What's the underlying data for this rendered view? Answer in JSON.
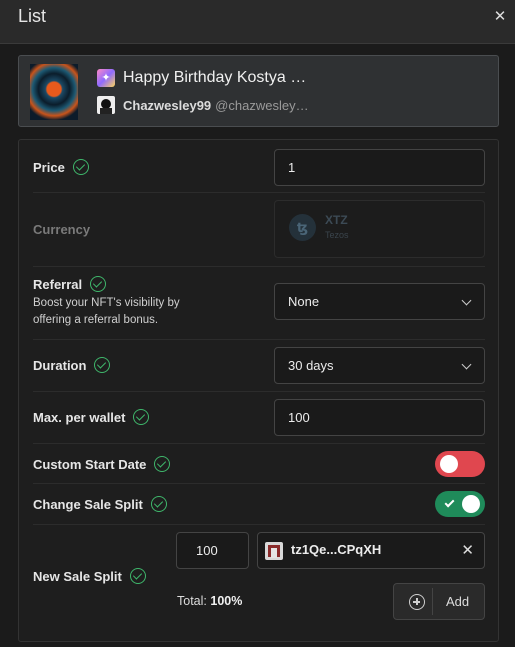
{
  "header": {
    "title": "List",
    "close_icon": "close-icon"
  },
  "nft": {
    "title": "Happy Birthday Kostya …",
    "title_icon": "party-popper-icon",
    "artist_name": "Chazwesley99",
    "artist_handle": "@chazwesley…"
  },
  "form": {
    "price": {
      "label": "Price",
      "value": "1"
    },
    "currency": {
      "label": "Currency",
      "symbol": "XTZ",
      "name": "Tezos",
      "logo_glyph": "ꜩ"
    },
    "referral": {
      "label": "Referral",
      "description": "Boost your NFT's visibility by offering a referral bonus.",
      "value": "None"
    },
    "duration": {
      "label": "Duration",
      "value": "30 days"
    },
    "max_per_wallet": {
      "label": "Max. per wallet",
      "value": "100"
    },
    "custom_start_date": {
      "label": "Custom Start Date",
      "enabled": false
    },
    "change_sale_split": {
      "label": "Change Sale Split",
      "enabled": true
    },
    "new_sale_split": {
      "label": "New Sale Split",
      "share": "100",
      "address": "tz1Qe...CPqXH",
      "total_label": "Total:",
      "total_value": "100%",
      "add_label": "Add"
    }
  },
  "colors": {
    "accent_green": "#3fb66b",
    "toggle_off": "#e0474f",
    "toggle_on": "#1f8b5a"
  }
}
